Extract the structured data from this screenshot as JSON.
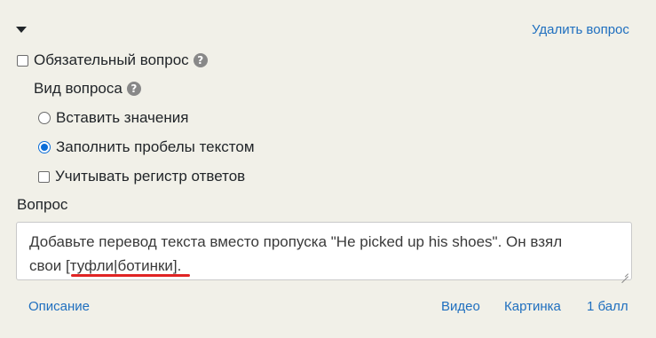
{
  "header": {
    "delete_label": "Удалить вопрос"
  },
  "required": {
    "label": "Обязательный вопрос",
    "checked": false,
    "help_icon": "question-circle-icon"
  },
  "question_type": {
    "label": "Вид вопроса",
    "help_icon": "question-circle-icon",
    "options": [
      {
        "label": "Вставить значения",
        "selected": false
      },
      {
        "label": "Заполнить пробелы текстом",
        "selected": true
      }
    ],
    "case_sensitive": {
      "label": "Учитывать регистр ответов",
      "checked": false
    }
  },
  "question": {
    "label": "Вопрос",
    "text_line1": "Добавьте перевод текста вместо пропуска \"He picked up his shoes\". Он взял",
    "text_line2": "свои [туфли|ботинки]."
  },
  "footer": {
    "description_label": "Описание",
    "video_label": "Видео",
    "image_label": "Картинка",
    "points_label": "1 балл"
  }
}
